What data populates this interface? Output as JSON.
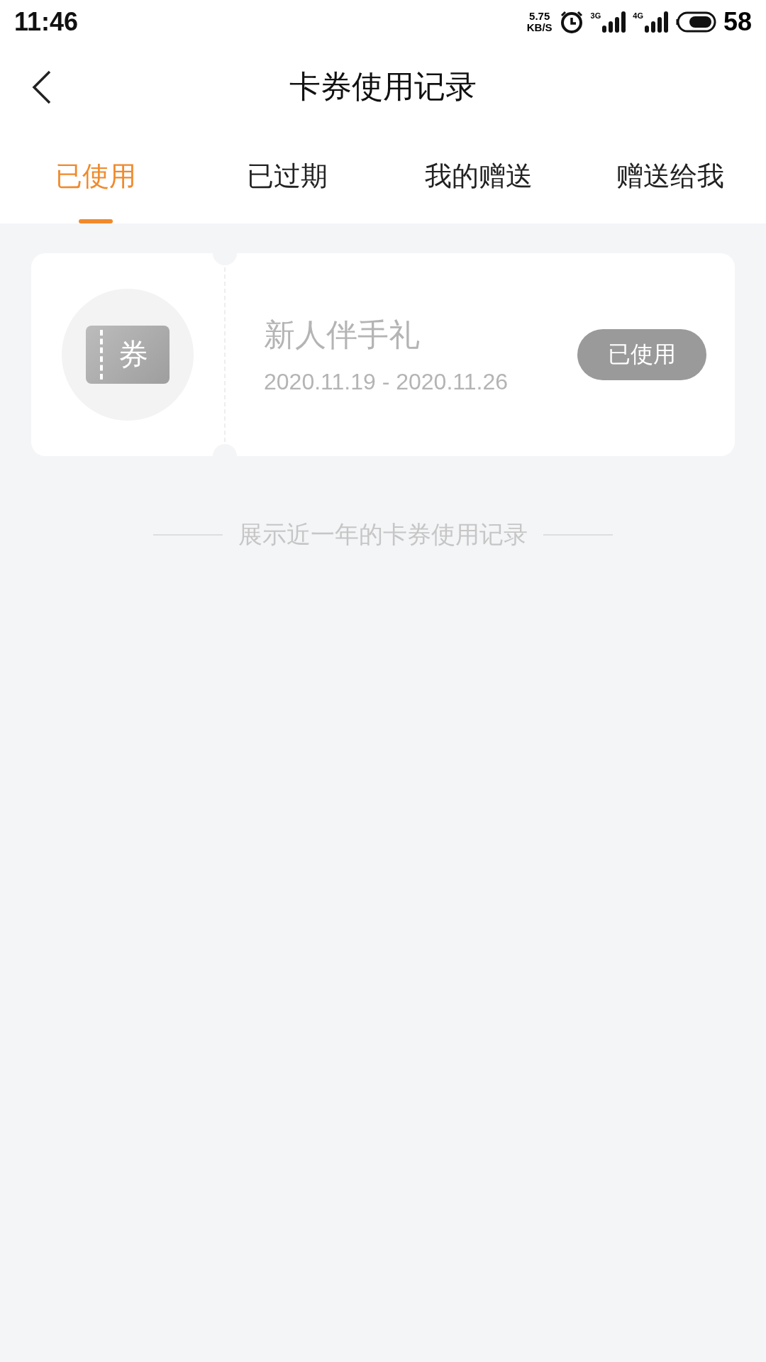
{
  "status_bar": {
    "time": "11:46",
    "speed_value": "5.75",
    "speed_unit": "KB/S",
    "network_1": "3G",
    "network_2": "4G",
    "battery": "58"
  },
  "header": {
    "title": "卡券使用记录"
  },
  "tabs": [
    {
      "label": "已使用",
      "selected": true
    },
    {
      "label": "已过期",
      "selected": false
    },
    {
      "label": "我的赠送",
      "selected": false
    },
    {
      "label": "赠送给我",
      "selected": false
    }
  ],
  "coupons": [
    {
      "icon_text": "券",
      "name": "新人伴手礼",
      "period": "2020.11.19 - 2020.11.26",
      "status": "已使用",
      "disabled": true
    }
  ],
  "footer_note": "展示近一年的卡券使用记录"
}
